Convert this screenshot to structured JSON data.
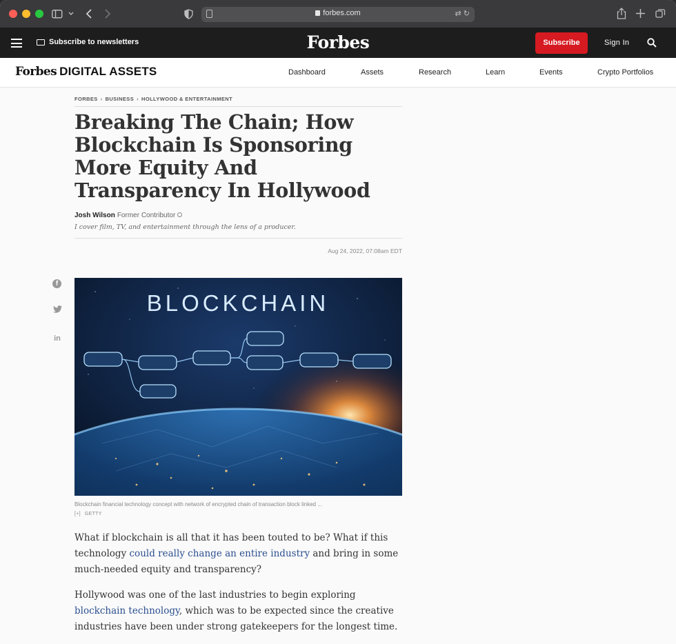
{
  "browser": {
    "url": "forbes.com"
  },
  "topnav": {
    "newsletter_label": "Subscribe to newsletters",
    "logo": "Forbes",
    "subscribe_label": "Subscribe",
    "sign_in_label": "Sign In"
  },
  "section_bar": {
    "logo_forbes": "Forbes",
    "logo_section": "DIGITAL ASSETS",
    "links": [
      "Dashboard",
      "Assets",
      "Research",
      "Learn",
      "Events",
      "Crypto Portfolios"
    ]
  },
  "breadcrumb": [
    "FORBES",
    "BUSINESS",
    "HOLLYWOOD & ENTERTAINMENT"
  ],
  "article": {
    "headline": "Breaking The Chain; How Blockchain Is Sponsoring More Equity And Transparency In Hollywood",
    "author_name": "Josh Wilson",
    "author_role": "Former Contributor",
    "author_bio": "I cover film, TV, and entertainment through the lens of a producer.",
    "date": "Aug 24, 2022, 07:08am EDT",
    "hero_text": "BLOCKCHAIN",
    "caption": "Blockchain financial technology concept with network of encrypted chain of transaction block linked ...",
    "caption_expand": "[+]",
    "credit": "GETTY",
    "p1_before": "What if blockchain is all that it has been touted to be? What if this technology ",
    "p1_link": "could really change an entire industry",
    "p1_after": " and bring in some much-needed equity and transparency?",
    "p2_before": "Hollywood was one of the last industries to begin exploring ",
    "p2_link": "blockchain technology",
    "p2_after": ", which was to be expected since the creative industries have been under strong gatekeepers for the longest time."
  },
  "share": {
    "facebook": "f",
    "twitter": "🐦",
    "linkedin": "in"
  }
}
